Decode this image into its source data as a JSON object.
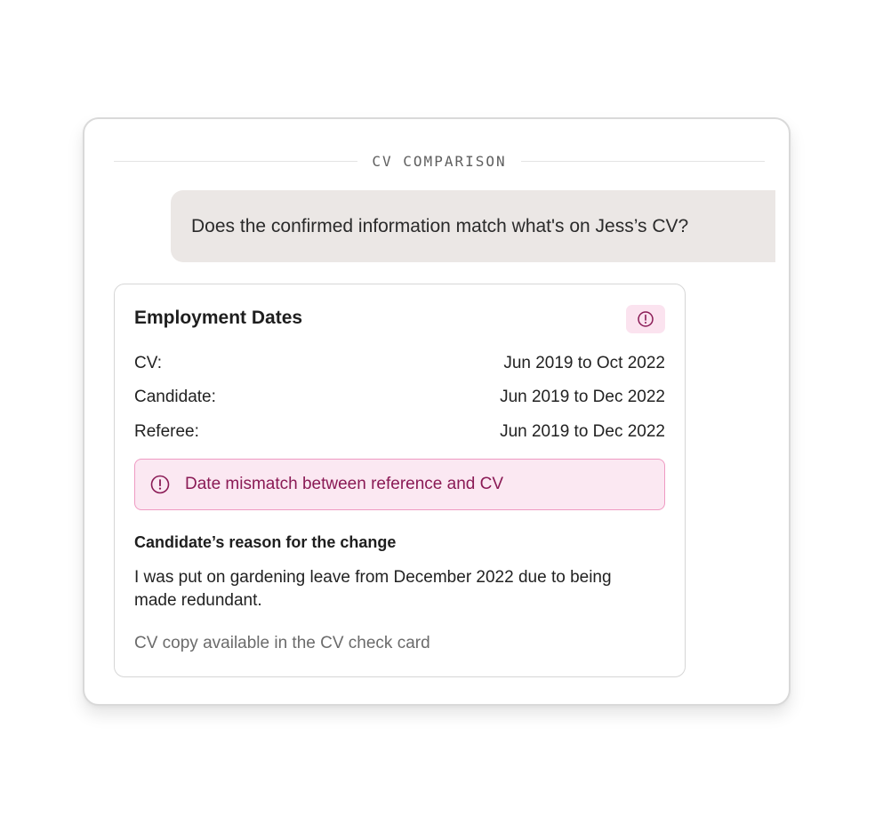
{
  "section": {
    "title": "CV COMPARISON"
  },
  "question": {
    "text": "Does the confirmed information match what's on Jess’s CV?"
  },
  "card": {
    "title": "Employment Dates",
    "badge_icon": "alert-circle-icon",
    "rows": [
      {
        "label": "CV:",
        "value": "Jun 2019 to Oct 2022"
      },
      {
        "label": "Candidate:",
        "value": "Jun 2019 to Dec 2022"
      },
      {
        "label": "Referee:",
        "value": "Jun 2019 to Dec 2022"
      }
    ],
    "alert": {
      "icon": "alert-circle-icon",
      "text": "Date mismatch between reference and CV"
    },
    "reason_heading": "Candidate’s reason for the change",
    "reason_text": "I was put on gardening leave from December 2022 due to being made redundant.",
    "note": "CV copy available in the CV check card"
  },
  "colors": {
    "alert_accent": "#8a1a55",
    "alert_background": "#fbe8f2",
    "alert_border": "#ef9ac2",
    "question_bubble": "#ebe7e5"
  }
}
